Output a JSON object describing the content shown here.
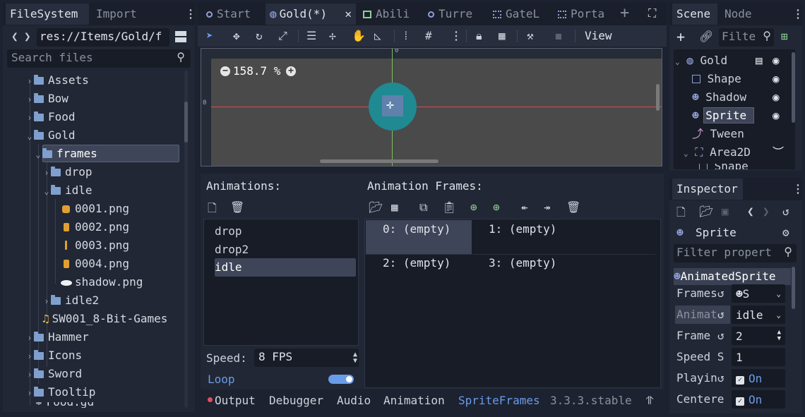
{
  "filesystem": {
    "tabs": [
      "FileSystem",
      "Import"
    ],
    "path": "res://Items/Gold/f",
    "search_placeholder": "Search files",
    "tree": [
      {
        "label": "Assets",
        "type": "folder",
        "arrow": "›"
      },
      {
        "label": "Bow",
        "type": "folder",
        "arrow": "›"
      },
      {
        "label": "Food",
        "type": "folder",
        "arrow": "›"
      },
      {
        "label": "Gold",
        "type": "folder",
        "arrow": "⌄"
      },
      {
        "label": "frames",
        "type": "folder",
        "arrow": "⌄"
      },
      {
        "label": "drop",
        "type": "folder",
        "arrow": "›"
      },
      {
        "label": "idle",
        "type": "folder",
        "arrow": "⌄"
      },
      {
        "label": "0001.png",
        "type": "png"
      },
      {
        "label": "0002.png",
        "type": "png"
      },
      {
        "label": "0003.png",
        "type": "png"
      },
      {
        "label": "0004.png",
        "type": "png"
      },
      {
        "label": "shadow.png",
        "type": "shadow"
      },
      {
        "label": "idle2",
        "type": "folder",
        "arrow": "›"
      },
      {
        "label": "SW001_8-Bit-Games",
        "type": "audio"
      },
      {
        "label": "Hammer",
        "type": "folder",
        "arrow": "›"
      },
      {
        "label": "Icons",
        "type": "folder",
        "arrow": "›"
      },
      {
        "label": "Sword",
        "type": "folder",
        "arrow": "›"
      },
      {
        "label": "Tooltip",
        "type": "folder",
        "arrow": "›"
      },
      {
        "label": "Food.gd",
        "type": "script"
      }
    ]
  },
  "editor_tabs": [
    "Start",
    "Gold(*)",
    "Abili",
    "Turre",
    "GateL",
    "Porta"
  ],
  "toolbar": {
    "view_label": "View"
  },
  "viewport": {
    "zoom": "158.7 %",
    "ruler_zero": "0"
  },
  "animations": {
    "title": "Animations:",
    "items": [
      "drop",
      "drop2",
      "idle"
    ],
    "selected": "idle",
    "speed_label": "Speed:",
    "speed_value": "8 FPS",
    "loop_label": "Loop",
    "loop_on": true
  },
  "frames": {
    "title": "Animation Frames:",
    "items": [
      "0: (empty)",
      "1: (empty)",
      "2: (empty)",
      "3: (empty)"
    ]
  },
  "bottom_tabs": [
    "Output",
    "Debugger",
    "Audio",
    "Animation",
    "SpriteFrames"
  ],
  "version": "3.3.3.stable",
  "scene": {
    "tabs": [
      "Scene",
      "Node"
    ],
    "filter_placeholder": "Filte",
    "nodes": [
      {
        "label": "Gold",
        "icon": "node2d"
      },
      {
        "label": "Shape",
        "icon": "shape"
      },
      {
        "label": "Shadow",
        "icon": "sprite"
      },
      {
        "label": "Sprite",
        "icon": "sprite"
      },
      {
        "label": "Tween",
        "icon": "tween"
      },
      {
        "label": "Area2D",
        "icon": "area"
      },
      {
        "label": "Shape",
        "icon": "shape"
      }
    ]
  },
  "inspector": {
    "tab": "Inspector",
    "node": "Sprite",
    "filter_placeholder": "Filter propert",
    "section": "AnimatedSprite",
    "props": [
      {
        "label": "Frames",
        "value": "S"
      },
      {
        "label": "Animat",
        "value": "idle"
      },
      {
        "label": "Frame",
        "value": "2"
      },
      {
        "label": "Speed S",
        "value": "1"
      },
      {
        "label": "Playin",
        "value": "On"
      },
      {
        "label": "Centere",
        "value": "On"
      }
    ]
  },
  "colors": {
    "accent": "#699ce8",
    "selection": "#3e4558"
  }
}
